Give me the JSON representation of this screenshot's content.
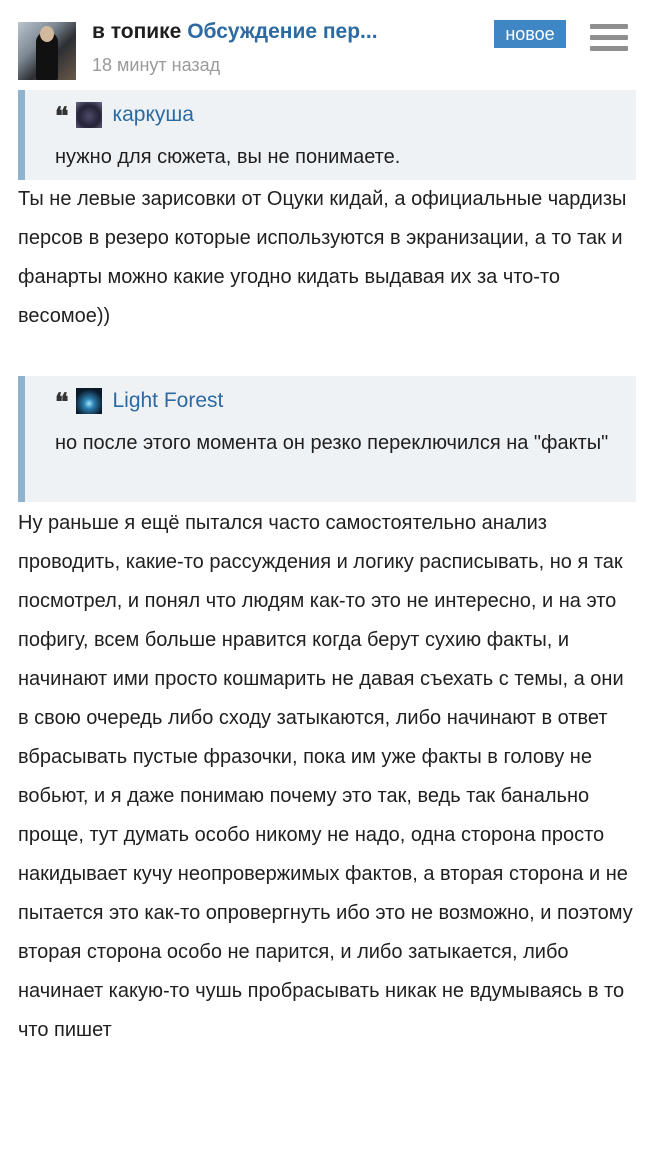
{
  "header": {
    "topic_prefix": "в топике",
    "topic_title": "Обсуждение пер...",
    "time": "18 минут назад",
    "badge": "новое"
  },
  "quotes": [
    {
      "author": "каркуша",
      "text": "нужно для сюжета, вы не понимаете."
    },
    {
      "author": "Light Forest",
      "text": "но после этого момента он резко переключился на \"факты\""
    }
  ],
  "paragraphs": [
    "Ты не левые зарисовки от Оцуки кидай, а официальные чардизы персов в резеро которые используются в экранизации, а то так и фанарты можно какие угодно кидать выдавая их за что-то весомое))",
    "Ну раньше я ещё пытался часто самостоятельно анализ проводить, какие-то рассуждения и логику расписывать, но я так посмотрел, и понял что людям как-то это не интересно, и на это пофигу, всем больше нравится когда берут сухию факты, и начинают ими просто кошмарить не давая съехать с темы, а они в свою очередь либо сходу затыкаются, либо начинают в ответ вбрасывать пустые фразочки, пока им уже факты в голову не вобьют, и я даже понимаю почему это так, ведь так банально проще, тут думать особо никому не надо, одна сторона просто накидывает кучу неопровержимых фактов, а вторая сторона и не пытается это как-то опровергнуть ибо это не возможно, и поэтому вторая сторона особо не парится, и либо затыкается, либо начинает какую-то чушь пробрасывать никак не вдумываясь в то что пишет"
  ],
  "icons": {
    "menu": "hamburger-menu-icon",
    "quote": "quote-mark-icon"
  }
}
